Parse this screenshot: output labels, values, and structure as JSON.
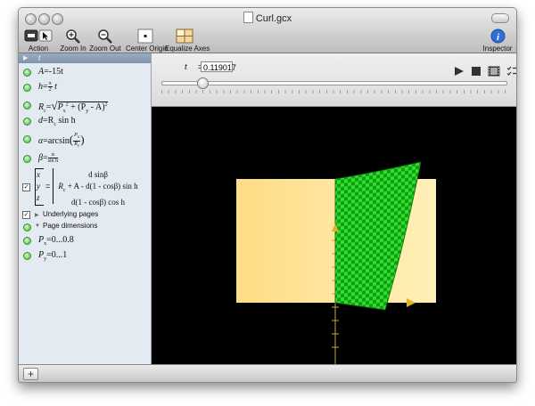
{
  "window": {
    "title": "Curl.gcx"
  },
  "toolbar": {
    "action": "Action",
    "zoom_in": "Zoom In",
    "zoom_out": "Zoom Out",
    "center_origin": "Center Origin",
    "equalize_axes": "Equalize Axes",
    "inspector": "Inspector"
  },
  "sidebar": {
    "header_var": "t",
    "A_lhs": "A",
    "A_rhs": "=-15t",
    "h_lhs": "h",
    "h_eq": "=",
    "h_num": "π",
    "h_den": "2",
    "h_tail": "t",
    "Rc_lhs": "R",
    "Rc_sub": "c",
    "Rc_eq": "=",
    "Rc_body": "P",
    "Rc_body_sub": "x",
    "Rc_body_sup": "2",
    "Rc_plus": "+ (P",
    "Rc_plus_sub": "y",
    "Rc_minus": "- A)",
    "Rc_sup": "2",
    "d_lhs": "d",
    "d_rhs": "=R",
    "d_sub": "c",
    "d_tail": "sin h",
    "alpha_lhs": "α",
    "alpha_eq": "=arcsin",
    "alpha_num": "P",
    "alpha_num_sub": "x",
    "alpha_den": "R",
    "alpha_den_sub": "c",
    "beta_lhs": "β",
    "beta_eq": "=",
    "beta_num": "α",
    "beta_den": "sin h",
    "vec_x": "x",
    "vec_y": "y",
    "vec_z": "z",
    "vec_r1": "d sinβ",
    "vec_r2": "R",
    "vec_r2_sub": "c",
    "vec_r2_tail": "+ A - d(1 - cosβ) sin h",
    "vec_r3": "d(1 - cosβ) cos h",
    "underlying": "Underlying pages",
    "page_dims": "Page dimensions",
    "px_lhs": "P",
    "px_sub": "x",
    "px_rhs": "=0...0.8",
    "py_lhs": "P",
    "py_sub": "y",
    "py_rhs": "=0...1"
  },
  "controls": {
    "t_label": "t",
    "t_value": "0.119017",
    "slider_value": 0.119
  },
  "bottom": {
    "add_label": "+"
  },
  "colors": {
    "accent_green": "#1fcc1f",
    "page_yellow": "#ffe79a",
    "canvas_bg": "#000000"
  }
}
